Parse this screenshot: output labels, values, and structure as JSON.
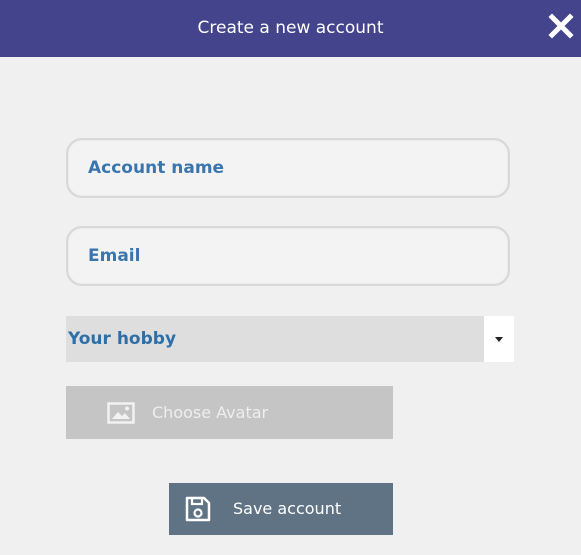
{
  "dialog": {
    "title": "Create a new account",
    "close_icon": "close-icon"
  },
  "form": {
    "account_name_placeholder": "Account name",
    "account_name_value": "",
    "email_placeholder": "Email",
    "email_value": "",
    "hobby_selected": "Your hobby",
    "choose_avatar_label": "Choose Avatar",
    "avatar_icon": "image-icon",
    "save_label": "Save account",
    "save_icon": "floppy-disk-icon"
  },
  "colors": {
    "titlebar": "#43448b",
    "field_text": "#2e6fa8",
    "avatar_button": "#c5c5c5",
    "save_button": "#5f7385"
  }
}
